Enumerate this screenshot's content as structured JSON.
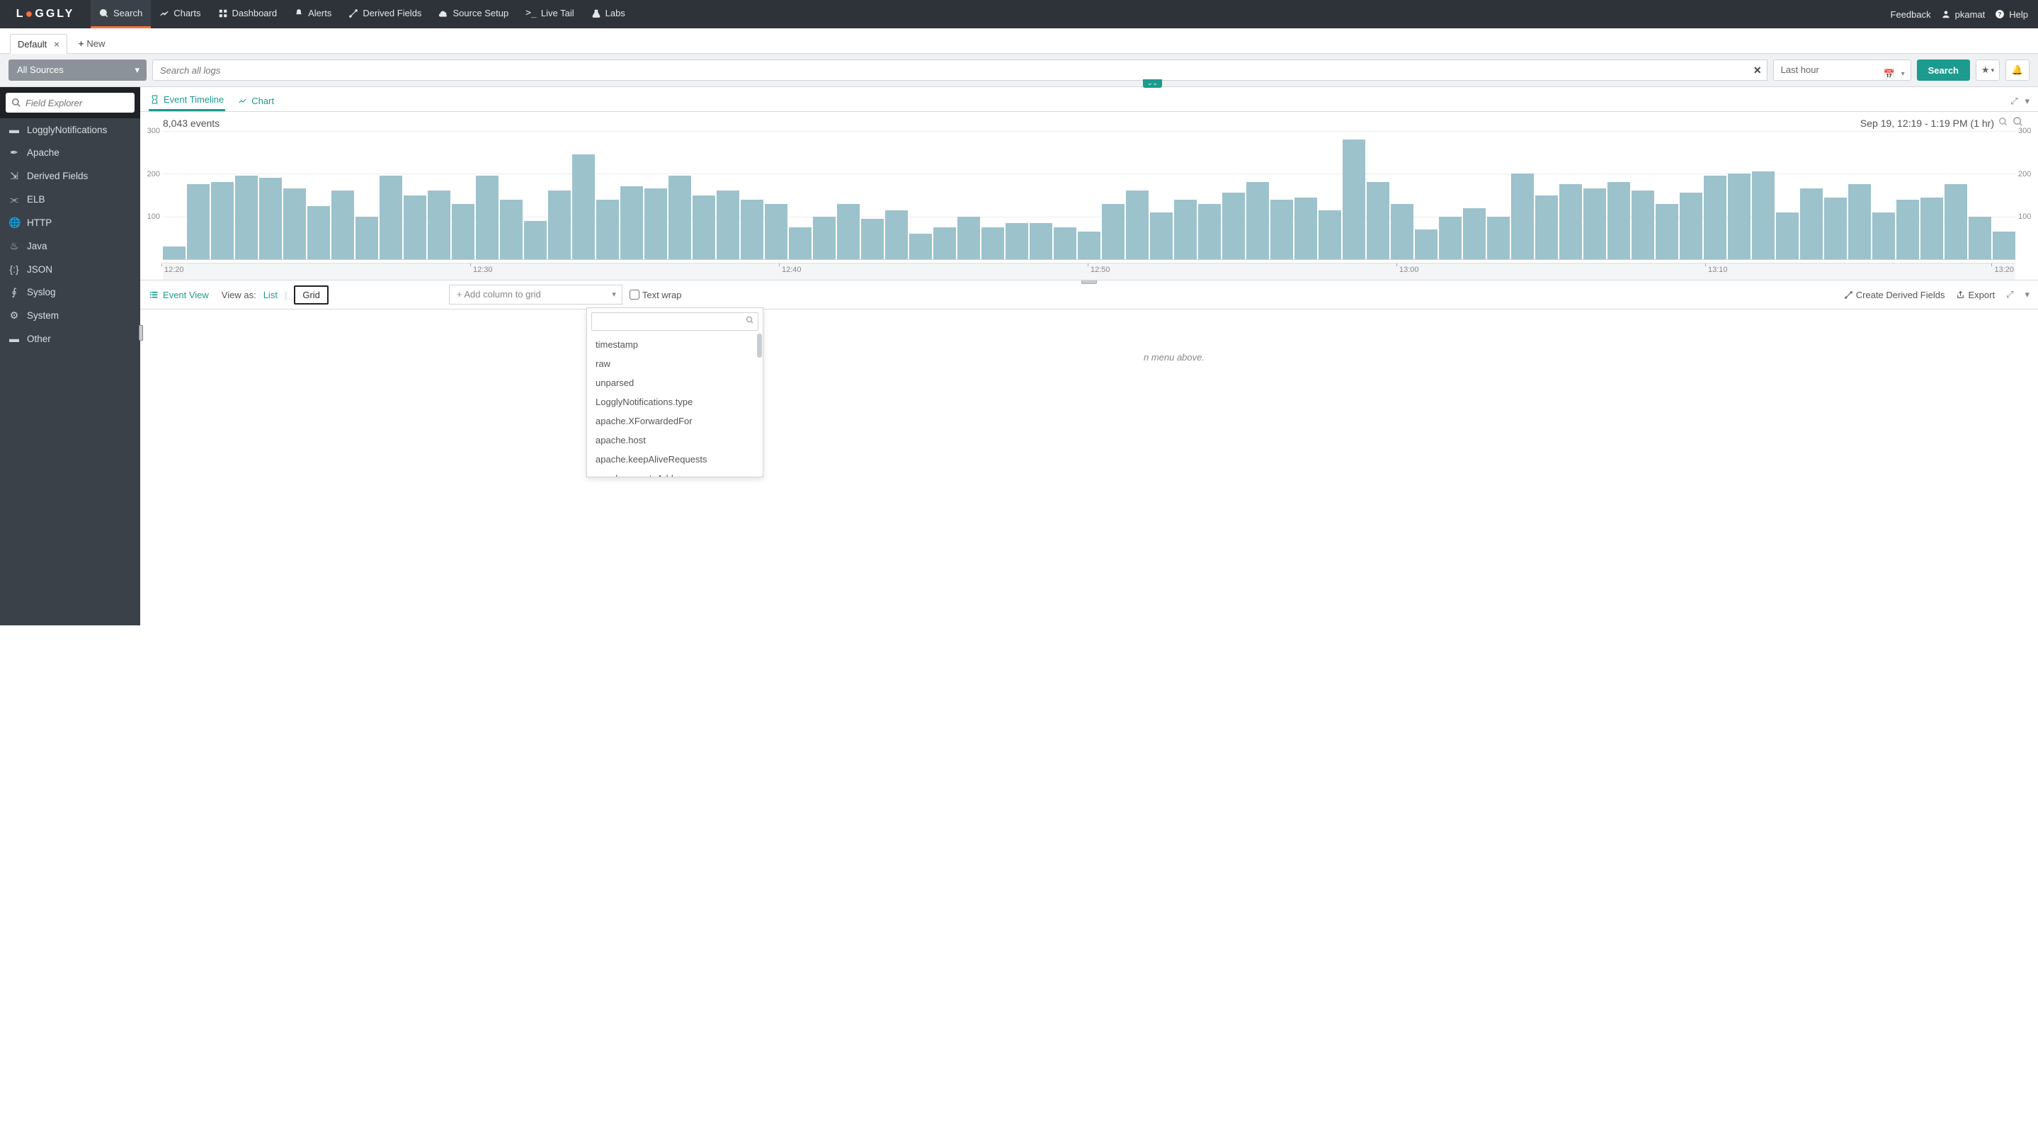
{
  "brand": "LOGGLY",
  "topnav": {
    "items": [
      {
        "label": "Search",
        "icon": "search",
        "active": true
      },
      {
        "label": "Charts",
        "icon": "chart"
      },
      {
        "label": "Dashboard",
        "icon": "dashboard"
      },
      {
        "label": "Alerts",
        "icon": "alert"
      },
      {
        "label": "Derived Fields",
        "icon": "derived"
      },
      {
        "label": "Source Setup",
        "icon": "cloud"
      },
      {
        "label": "Live Tail",
        "icon": "livetail"
      },
      {
        "label": "Labs",
        "icon": "labs"
      }
    ],
    "right": {
      "feedback": "Feedback",
      "user": "pkamat",
      "help": "Help"
    }
  },
  "tabs": {
    "active": "Default",
    "new_label": "New"
  },
  "search_row": {
    "source_select": "All Sources",
    "search_placeholder": "Search all logs",
    "timerange": "Last hour",
    "search_btn": "Search"
  },
  "sidebar": {
    "field_explorer_placeholder": "Field Explorer",
    "items": [
      {
        "label": "LogglyNotifications",
        "icon": "db"
      },
      {
        "label": "Apache",
        "icon": "feather"
      },
      {
        "label": "Derived Fields",
        "icon": "derived"
      },
      {
        "label": "ELB",
        "icon": "share"
      },
      {
        "label": "HTTP",
        "icon": "globe"
      },
      {
        "label": "Java",
        "icon": "java"
      },
      {
        "label": "JSON",
        "icon": "json"
      },
      {
        "label": "Syslog",
        "icon": "syslog"
      },
      {
        "label": "System",
        "icon": "system"
      },
      {
        "label": "Other",
        "icon": "db"
      }
    ]
  },
  "chart_tabs": {
    "timeline": "Event Timeline",
    "chart": "Chart"
  },
  "chart_head": {
    "events_count": "8,043 events",
    "range_text": "Sep 19, 12:19 - 1:19 PM  (1 hr)"
  },
  "chart_data": {
    "type": "bar",
    "ylabel": "",
    "xlabel": "",
    "ylim": [
      0,
      300
    ],
    "y_ticks": [
      100,
      200,
      300
    ],
    "x_ticks": [
      "12:20",
      "12:30",
      "12:40",
      "12:50",
      "13:00",
      "13:10",
      "13:20"
    ],
    "values": [
      30,
      175,
      180,
      195,
      190,
      165,
      125,
      160,
      100,
      195,
      150,
      160,
      130,
      195,
      140,
      90,
      160,
      245,
      140,
      170,
      165,
      195,
      150,
      160,
      140,
      130,
      75,
      100,
      130,
      95,
      115,
      60,
      75,
      100,
      75,
      85,
      85,
      75,
      65,
      130,
      160,
      110,
      140,
      130,
      155,
      180,
      140,
      145,
      115,
      280,
      180,
      130,
      70,
      100,
      120,
      100,
      200,
      150,
      175,
      165,
      180,
      160,
      130,
      155,
      195,
      200,
      205,
      110,
      165,
      145,
      175,
      110,
      140,
      145,
      175,
      100,
      65
    ]
  },
  "event_view": {
    "title": "Event View",
    "view_as_label": "View as:",
    "list_label": "List",
    "grid_label": "Grid",
    "add_column_label": "+ Add column to grid",
    "text_wrap_label": "Text wrap",
    "create_derived": "Create Derived Fields",
    "export": "Export"
  },
  "dropdown": {
    "items": [
      "timestamp",
      "raw",
      "unparsed",
      "LogglyNotifications.type",
      "apache.XForwardedFor",
      "apache.host",
      "apache.keepAliveRequests",
      "apache.remoteAddr"
    ]
  },
  "hint": "n menu above.",
  "colors": {
    "accent": "#1c9b8e",
    "brand_orange": "#f9703e",
    "bar": "#9cc2cc"
  }
}
